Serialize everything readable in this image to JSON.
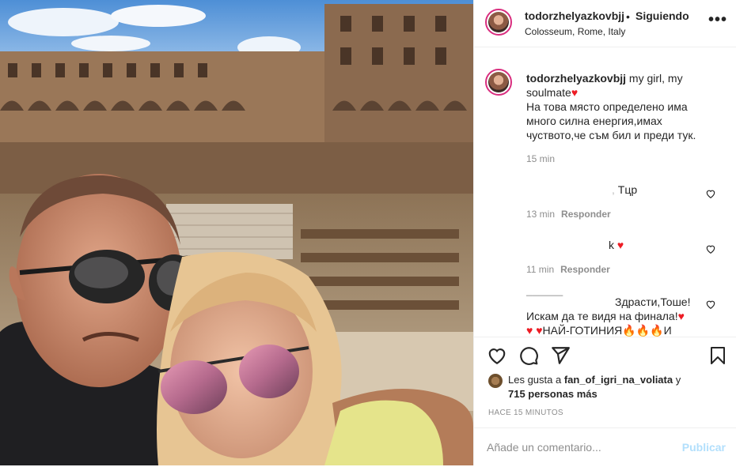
{
  "header": {
    "username": "todorzhelyazkovbjj",
    "separator": "•",
    "follow_status": "Siguiendo",
    "location": "Colosseum, Rome, Italy",
    "more_label": "•••"
  },
  "caption": {
    "username": "todorzhelyazkovbjj",
    "text_line1": "my girl, my soulmate",
    "text_body": "На това място определено има много силна енергия,имах чуството,че съм бил и преди тук.",
    "time": "15 min"
  },
  "comments": [
    {
      "text": "Тцр",
      "time": "13 min",
      "reply": "Responder"
    },
    {
      "text": "k",
      "time": "11 min",
      "reply": "Responder"
    },
    {
      "text_line1": "Здрасти,Тоше!",
      "text_line2": "Искам да те видя на финала!",
      "text_line3": "НАЙ-ГОТИНИЯ",
      "text_line3_end": "И"
    }
  ],
  "likes": {
    "prefix": "Les gusta a ",
    "user": "fan_of_igri_na_voliata",
    "mid": " y",
    "count": "715 personas más"
  },
  "timestamp": "HACE 15 MINUTOS",
  "add_comment": {
    "placeholder": "Añade un comentario...",
    "publish": "Publicar"
  },
  "colors": {
    "accent_blue": "#b2dffc",
    "heart_red": "#ed1c24",
    "story_ring": "#d92e7f"
  },
  "icons": [
    "heart-icon",
    "comment-icon",
    "share-icon",
    "bookmark-icon",
    "more-icon"
  ]
}
